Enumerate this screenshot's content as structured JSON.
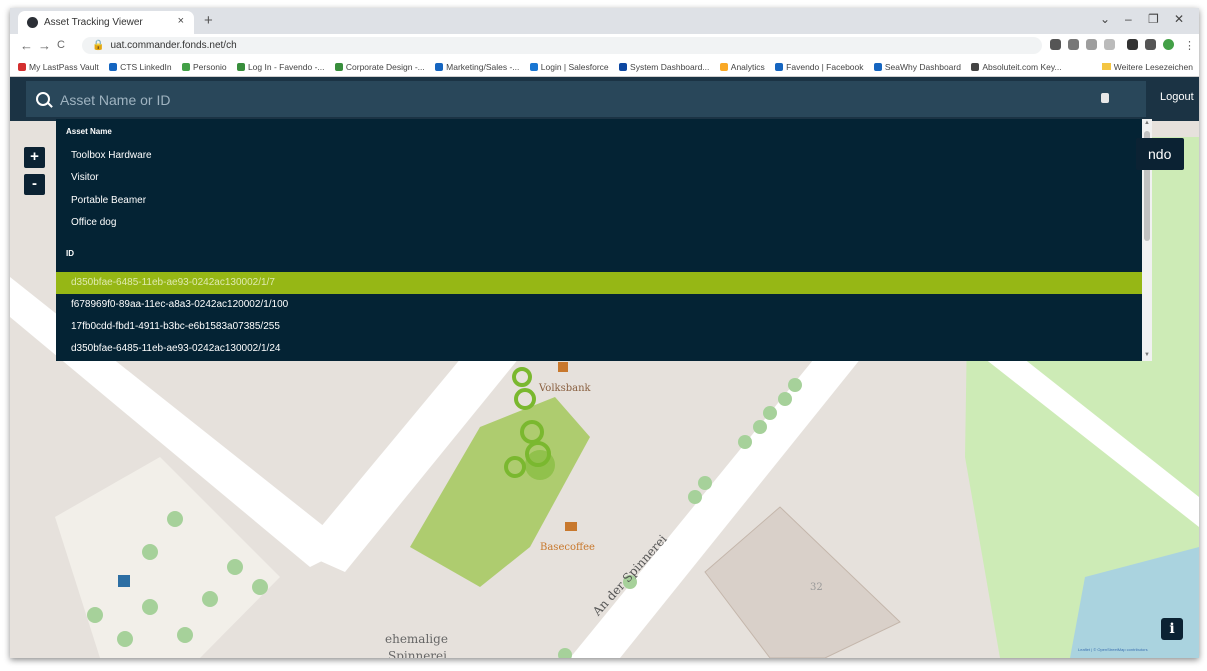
{
  "browser": {
    "tab_title": "Asset Tracking Viewer",
    "tab_close": "×",
    "new_tab": "+",
    "window_controls": [
      "⌄",
      "–",
      "❐",
      "✕"
    ],
    "url": "uat.commander.fonds.net/ch",
    "nav": [
      "←",
      "→",
      "C"
    ],
    "bookmarks": [
      {
        "label": "My LastPass Vault",
        "color": "#d32f2f"
      },
      {
        "label": "CTS LinkedIn",
        "color": "#1565c0"
      },
      {
        "label": "Personio",
        "color": "#43a047"
      },
      {
        "label": "Log In - Favendo -...",
        "color": "#388e3c"
      },
      {
        "label": "Corporate Design -...",
        "color": "#388e3c"
      },
      {
        "label": "Marketing/Sales -...",
        "color": "#1565c0"
      },
      {
        "label": "Login | Salesforce",
        "color": "#1976d2"
      },
      {
        "label": "System Dashboard...",
        "color": "#0d47a1"
      },
      {
        "label": "Analytics",
        "color": "#f9a825"
      },
      {
        "label": "Favendo | Facebook",
        "color": "#1565c0"
      },
      {
        "label": "SeaWhy Dashboard",
        "color": "#1565c0"
      },
      {
        "label": "Absoluteit.com Key...",
        "color": "#444444"
      }
    ],
    "bookmarks_right": "Weitere Lesezeichen"
  },
  "app": {
    "search_placeholder": "Asset Name or ID",
    "logout_label": "Logout",
    "brand_text": "ndo",
    "zoom_in": "+",
    "zoom_out": "-",
    "info_label": "i",
    "attribution": "Leaflet | © OpenStreetMap contributors",
    "dropdown": {
      "asset_header": "Asset Name",
      "assets": [
        "Toolbox Hardware",
        "Visitor",
        "Portable Beamer",
        "Office dog"
      ],
      "id_header": "ID",
      "ids": [
        "d350bfae-6485-11eb-ae93-0242ac130002/1/7",
        "f678969f0-89aa-11ec-a8a3-0242ac120002/1/100",
        "17fb0cdd-fbd1-4911-b3bc-e6b1583a07385/255",
        "d350bfae-6485-11eb-ae93-0242ac130002/1/24"
      ],
      "selected_index": 0
    }
  },
  "map_labels": {
    "volksbank": "Volksbank",
    "basecoffee": "Basecoffee",
    "street": "An der Spinnerei",
    "house_number": "32",
    "former": "ehemalige",
    "spinnerei": "Spinnerei"
  },
  "colors": {
    "appbar": "#1b3344",
    "dropdown": "#042334",
    "selected": "#96b715",
    "park": "#cdebb6"
  }
}
